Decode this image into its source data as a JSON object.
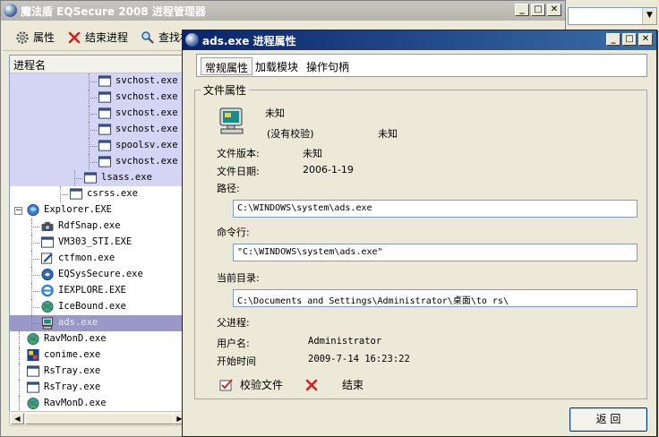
{
  "main_window": {
    "title": "魔法盾 EQSecure 2008 进程管理器",
    "toolbar": {
      "properties": "属性",
      "end_process": "结束进程",
      "find": "查找相"
    },
    "tree_header": "进程名",
    "processes": [
      {
        "name": "svchost.exe",
        "icon": "exe-window-icon"
      },
      {
        "name": "svchost.exe",
        "icon": "exe-window-icon"
      },
      {
        "name": "svchost.exe",
        "icon": "exe-window-icon"
      },
      {
        "name": "svchost.exe",
        "icon": "exe-window-icon"
      },
      {
        "name": "spoolsv.exe",
        "icon": "exe-window-icon"
      },
      {
        "name": "svchost.exe",
        "icon": "exe-window-icon"
      },
      {
        "name": "lsass.exe",
        "icon": "exe-window-icon"
      },
      {
        "name": "csrss.exe",
        "icon": "exe-window-icon"
      },
      {
        "name": "Explorer.EXE",
        "icon": "explorer-icon"
      },
      {
        "name": "RdfSnap.exe",
        "icon": "camera-icon"
      },
      {
        "name": "VM303_STI.EXE",
        "icon": "exe-window-icon"
      },
      {
        "name": "ctfmon.exe",
        "icon": "pen-icon"
      },
      {
        "name": "EQSysSecure.exe",
        "icon": "shield-icon"
      },
      {
        "name": "IEXPLORE.EXE",
        "icon": "ie-icon"
      },
      {
        "name": "IceBound.exe",
        "icon": "globe-icon"
      },
      {
        "name": "ads.exe",
        "icon": "computer-icon"
      },
      {
        "name": "RavMonD.exe",
        "icon": "globe-icon"
      },
      {
        "name": "conime.exe",
        "icon": "ime-icon"
      },
      {
        "name": "RsTray.exe",
        "icon": "exe-window-icon"
      },
      {
        "name": "RsTray.exe",
        "icon": "exe-window-icon"
      },
      {
        "name": "RavMonD.exe",
        "icon": "globe-icon"
      }
    ]
  },
  "dialog": {
    "title": "ads.exe 进程属性",
    "tabs": [
      "常规属性",
      "加载模块",
      "操作句柄"
    ],
    "active_tab": "常规属性",
    "group_title": "文件属性",
    "company": "未知",
    "signature": "(没有校验)",
    "signature_value": "未知",
    "file_version_label": "文件版本:",
    "file_version": "未知",
    "file_date_label": "文件日期:",
    "file_date": "2006-1-19",
    "path_label": "路径:",
    "path": "C:\\WINDOWS\\system\\ads.exe",
    "cmdline_label": "命令行:",
    "cmdline": "\"C:\\WINDOWS\\system\\ads.exe\"",
    "cwd_label": "当前目录:",
    "cwd": "C:\\Documents and Settings\\Administrator\\桌面\\to rs\\",
    "parent_label": "父进程:",
    "user_label": "用户名:",
    "user": "Administrator",
    "start_label": "开始时间",
    "start_time": "2009-7-14  16:23:22",
    "verify_label": "校验文件",
    "end_label": "结束",
    "back_label": "返 回"
  },
  "window_buttons": {
    "minimize": "_",
    "maximize": "□",
    "close": "✕"
  },
  "colors": {
    "selection": "#9a98c6",
    "highlight": "#d4d4f4",
    "active_title": "#0a246a"
  }
}
